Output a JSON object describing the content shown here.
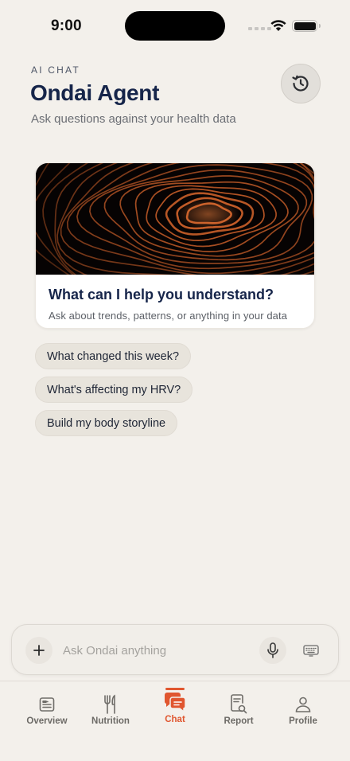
{
  "status_bar": {
    "time": "9:00"
  },
  "header": {
    "eyebrow": "AI CHAT",
    "title": "Ondai Agent",
    "subtitle": "Ask questions against your health data",
    "history_icon": "history-icon"
  },
  "hero": {
    "title": "What can I help you understand?",
    "subtitle": "Ask about trends, patterns, or anything in your data"
  },
  "suggestions": [
    {
      "label": "What changed this week?"
    },
    {
      "label": "What's affecting my HRV?"
    },
    {
      "label": "Build my body storyline"
    }
  ],
  "composer": {
    "placeholder": "Ask Ondai anything",
    "value": "",
    "plus_icon": "plus-icon",
    "mic_icon": "microphone-icon",
    "keyboard_icon": "keyboard-icon"
  },
  "tabs": [
    {
      "label": "Overview",
      "icon": "overview-icon",
      "active": false
    },
    {
      "label": "Nutrition",
      "icon": "fork-knife-icon",
      "active": false
    },
    {
      "label": "Chat",
      "icon": "chat-bubbles-icon",
      "active": true
    },
    {
      "label": "Report",
      "icon": "report-search-icon",
      "active": false
    },
    {
      "label": "Profile",
      "icon": "person-icon",
      "active": false
    }
  ],
  "colors": {
    "background": "#f3f0eb",
    "title": "#16254a",
    "accent": "#e0562f",
    "chip": "#e8e4dc",
    "hero_art_line": "#d9662c"
  }
}
